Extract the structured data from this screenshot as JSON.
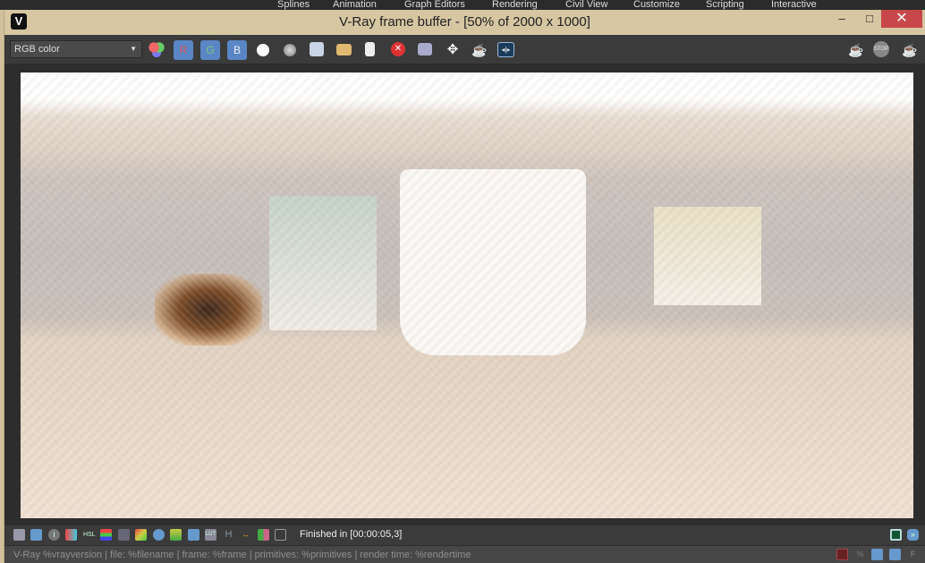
{
  "background_menu": [
    "Splines",
    "Animation",
    "Graph Editors",
    "Rendering",
    "Civil View",
    "Customize",
    "Scripting",
    "Interactive"
  ],
  "window": {
    "title": "V-Ray frame buffer - [50% of 2000 x 1000]",
    "minimize": "–",
    "maximize": "□",
    "close": "✕"
  },
  "toolbar": {
    "channel": "RGB color",
    "r": "R",
    "g": "G",
    "b": "B"
  },
  "status": {
    "text": "Finished in [00:00:05,3]"
  },
  "info": {
    "text": "V-Ray %vrayversion | file: %filename | frame: %frame | primitives: %primitives | render time: %rendertime"
  },
  "bottom_right": {
    "percent": "%",
    "f": "F"
  },
  "colors": {
    "frame": "#d6c6a2",
    "toolbar": "#3b3b3b",
    "accent": "#5a86c6",
    "close": "#c7474a"
  }
}
